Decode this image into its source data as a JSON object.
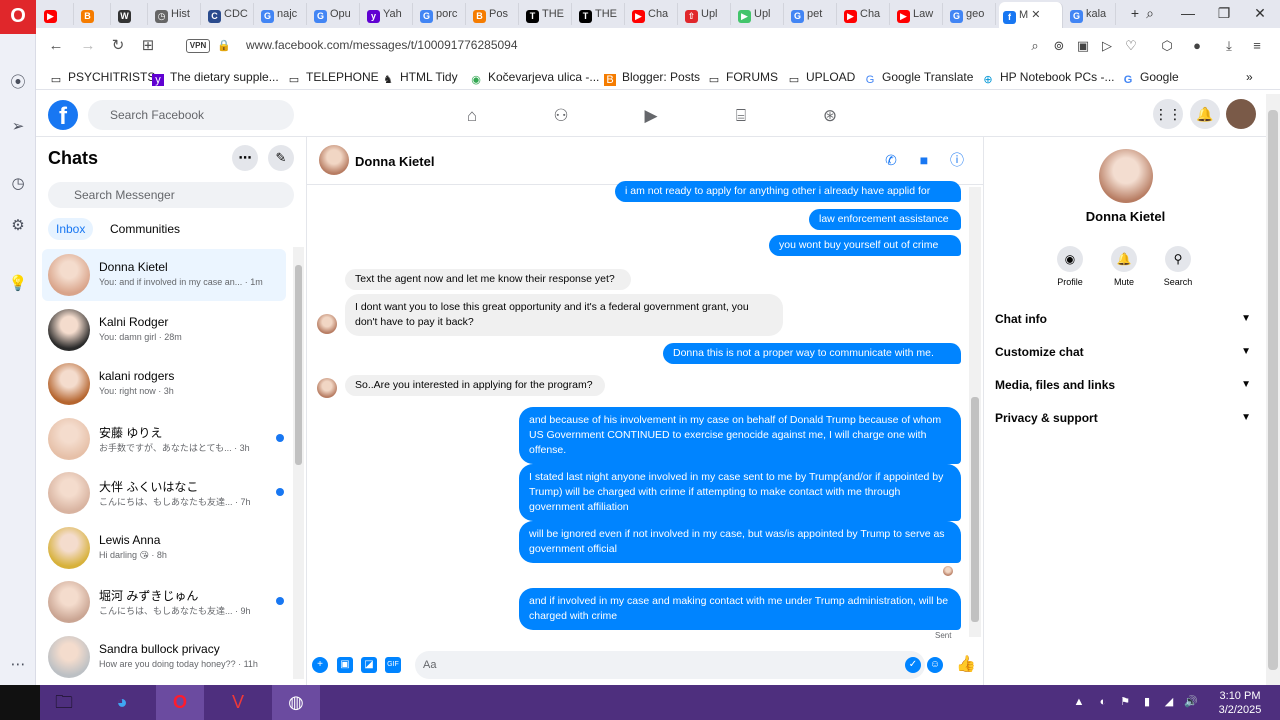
{
  "browser": {
    "tabs": [
      {
        "label": "",
        "icon": "youtube-icon",
        "color": "#ff0000"
      },
      {
        "label": "",
        "icon": "blogger-icon",
        "color": "#f57c00"
      },
      {
        "label": "",
        "icon": "wikipedia-icon",
        "color": "#333333"
      },
      {
        "label": "Hist",
        "icon": "globe-icon",
        "color": "#666666"
      },
      {
        "label": "CDC",
        "icon": "cdc-icon",
        "color": "#2a4b8d"
      },
      {
        "label": "najc",
        "icon": "google-icon",
        "color": "#4285f4"
      },
      {
        "label": "Opu",
        "icon": "google-icon",
        "color": "#4285f4"
      },
      {
        "label": "Yah",
        "icon": "yahoo-icon",
        "color": "#6001d2"
      },
      {
        "label": "porc",
        "icon": "google-icon",
        "color": "#4285f4"
      },
      {
        "label": "Pos",
        "icon": "blogger-icon",
        "color": "#f57c00"
      },
      {
        "label": "THE",
        "icon": "nyt-icon",
        "color": "#000000"
      },
      {
        "label": "THE",
        "icon": "nyt-icon",
        "color": "#000000"
      },
      {
        "label": "Cha",
        "icon": "youtube-icon",
        "color": "#ff0000"
      },
      {
        "label": "Upl",
        "icon": "upload-icon",
        "color": "#e0272b"
      },
      {
        "label": "Upl",
        "icon": "play-icon",
        "color": "#43c56b"
      },
      {
        "label": "pet",
        "icon": "google-icon",
        "color": "#4285f4"
      },
      {
        "label": "Cha",
        "icon": "youtube-icon",
        "color": "#ff0000"
      },
      {
        "label": "Law",
        "icon": "youtube-icon",
        "color": "#ff0000"
      },
      {
        "label": "geo",
        "icon": "google-icon",
        "color": "#4285f4"
      },
      {
        "label": "M",
        "icon": "facebook-icon",
        "color": "#1877f2",
        "active": true
      },
      {
        "label": "kala",
        "icon": "google-icon",
        "color": "#4285f4"
      }
    ],
    "url": "www.facebook.com/messages/t/100091776285094",
    "vpn_label": "VPN",
    "bookmarks": [
      {
        "label": "PSYCHITRISTS",
        "icon": "folder-icon"
      },
      {
        "label": "The dietary supple...",
        "icon": "yahoo-icon"
      },
      {
        "label": "TELEPHONE",
        "icon": "folder-icon"
      },
      {
        "label": "HTML Tidy",
        "icon": "tidy-icon"
      },
      {
        "label": "Kočevarjeva ulica -...",
        "icon": "map-pin-icon"
      },
      {
        "label": "Blogger: Posts",
        "icon": "blogger-icon"
      },
      {
        "label": "FORUMS",
        "icon": "folder-icon"
      },
      {
        "label": "UPLOAD",
        "icon": "folder-icon"
      },
      {
        "label": "Google Translate",
        "icon": "translate-icon"
      },
      {
        "label": "HP Notebook PCs -...",
        "icon": "hp-icon"
      },
      {
        "label": "Google",
        "icon": "google-icon"
      }
    ]
  },
  "facebook": {
    "search_placeholder": "Search Facebook",
    "nav": [
      "home-icon",
      "friends-icon",
      "watch-icon",
      "marketplace-icon",
      "gaming-icon"
    ]
  },
  "chatlist": {
    "title": "Chats",
    "search_placeholder": "Search Messenger",
    "tabs": {
      "inbox": "Inbox",
      "communities": "Communities"
    },
    "items": [
      {
        "name": "Donna Kietel",
        "preview": "You: and if involved in my case an... · 1m",
        "unread": false,
        "selected": true,
        "avatar": "#d9a48a"
      },
      {
        "name": "Kalni Rodger",
        "preview": "You: damn girl · 28m",
        "unread": false,
        "avatar": "#2a2a2a"
      },
      {
        "name": "kalani rodgers",
        "preview": "You: right now · 3h",
        "unread": false,
        "avatar": "#b5652f"
      },
      {
        "name": "安藤 ゆりえ",
        "preview": "お手数ですが、あなたはとても... · 3h",
        "unread": true,
        "avatar": "#e6c0a8"
      },
      {
        "name": "大伴 ふくいはなこ",
        "preview": "こんにちは、もしあなたも友達... · 7h",
        "unread": true,
        "avatar": "#d8b3a0"
      },
      {
        "name": "Lewis Anna",
        "preview": "Hi darling 😘 · 8h",
        "unread": false,
        "avatar": "#d7b13a"
      },
      {
        "name": "堀河 みずきじゅん",
        "preview": "こんにちは、もしあなたも友達... · 9h",
        "unread": true,
        "avatar": "#caa593"
      },
      {
        "name": "Sandra bullock privacy",
        "preview": "How are you doing today honey?? · 11h",
        "unread": false,
        "avatar": "#bcc0c4"
      }
    ]
  },
  "conversation": {
    "name": "Donna Kietel",
    "messages": [
      {
        "from": "me",
        "text": "i am not ready to apply for anything other i already have applid for"
      },
      {
        "from": "me",
        "text": "law enforcement assistance"
      },
      {
        "from": "me",
        "text": "you wont buy yourself out of crime"
      },
      {
        "from": "them",
        "text": "Text the agent now and let me know their response yet?"
      },
      {
        "from": "them",
        "text": "I dont want you to lose this great opportunity and it's a federal government grant, you don't have to pay it back?"
      },
      {
        "from": "me",
        "text": "Donna this is not a proper way to communicate with me."
      },
      {
        "from": "them",
        "text": "So..Are you interested in applying for the program?"
      },
      {
        "from": "me",
        "text": "and because of his involvement in my case on behalf of Donald Trump because of whom US Government CONTINUED to exercise genocide against me, I will charge one with offense."
      },
      {
        "from": "me",
        "text": "I stated last night anyone involved in my case sent to me by Trump(and/or if appointed by Trump) will be charged with crime if attempting to make contact with me through government affiliation"
      },
      {
        "from": "me",
        "text": "will be ignored even if not involved in my case, but was/is appointed by Trump to serve as government official"
      },
      {
        "from": "me",
        "text": "and if involved in my case and making contact with me under Trump administration, will be charged with crime"
      }
    ],
    "sent_label": "Sent",
    "input_placeholder": "Aa"
  },
  "info_panel": {
    "name": "Donna Kietel",
    "actions": [
      "Profile",
      "Mute",
      "Search"
    ],
    "sections": [
      "Chat info",
      "Customize chat",
      "Media, files and links",
      "Privacy & support"
    ]
  },
  "taskbar": {
    "time": "3:10 PM",
    "date": "3/2/2025"
  }
}
